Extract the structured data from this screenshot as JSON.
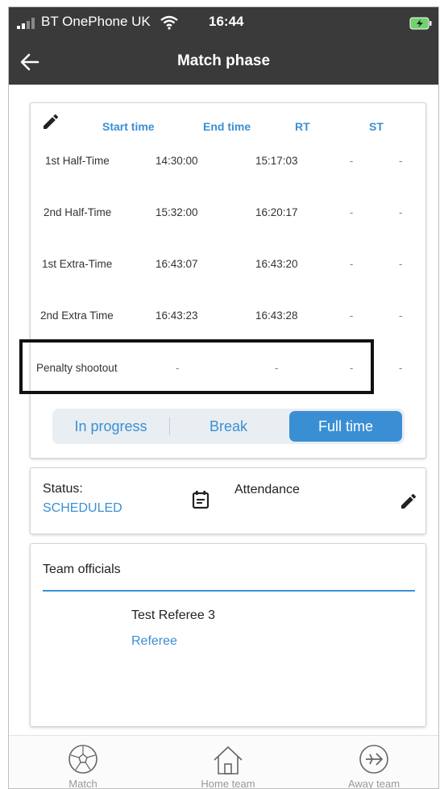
{
  "status_bar": {
    "carrier": "BT OnePhone UK",
    "time": "16:44",
    "battery_color": "#6fd26f"
  },
  "app_bar": {
    "title": "Match phase",
    "back_icon": "arrow-left-icon",
    "background": "#3a3a3a"
  },
  "phases": {
    "edit_icon": "pencil-icon",
    "headers": {
      "start": "Start time",
      "end": "End time",
      "rt": "RT",
      "st": "ST"
    },
    "rows": [
      {
        "label": "1st Half-Time",
        "start": "14:30:00",
        "end": "15:17:03",
        "rt": "-",
        "st": "-"
      },
      {
        "label": "2nd Half-Time",
        "start": "15:32:00",
        "end": "16:20:17",
        "rt": "-",
        "st": "-"
      },
      {
        "label": "1st Extra-Time",
        "start": "16:43:07",
        "end": "16:43:20",
        "rt": "-",
        "st": "-"
      },
      {
        "label": "2nd Extra Time",
        "start": "16:43:23",
        "end": "16:43:28",
        "rt": "-",
        "st": "-"
      },
      {
        "label": "Penalty shootout",
        "start": "-",
        "end": "-",
        "rt": "-",
        "st": "-"
      }
    ],
    "segments": [
      {
        "label": "In progress",
        "active": false
      },
      {
        "label": "Break",
        "active": false
      },
      {
        "label": "Full time",
        "active": true
      }
    ],
    "accent_color": "#3a8fd4"
  },
  "status_card": {
    "status_label": "Status:",
    "status_value": "SCHEDULED",
    "calendar_icon": "calendar-icon",
    "attendance_label": "Attendance",
    "edit_icon": "pencil-icon"
  },
  "officials_card": {
    "title": "Team officials",
    "official": {
      "name": "Test Referee 3",
      "role": "Referee"
    }
  },
  "bottom_nav": {
    "items": [
      {
        "label": "Match",
        "icon": "football-icon"
      },
      {
        "label": "Home team",
        "icon": "home-icon"
      },
      {
        "label": "Away team",
        "icon": "airplane-icon"
      }
    ]
  }
}
